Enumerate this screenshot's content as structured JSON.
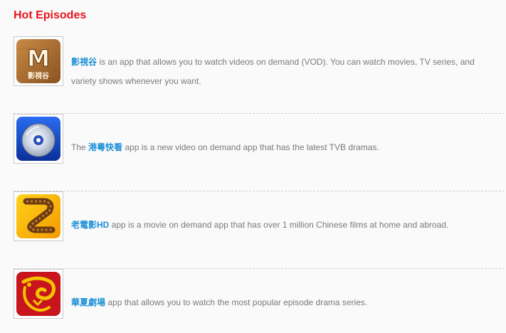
{
  "section": {
    "title": "Hot Episodes"
  },
  "episodes": [
    {
      "icon": "yingshigu-app-icon",
      "prefix": "",
      "name": "影視谷",
      "description": " is an app that allows you to watch videos on demand (VOD). You can watch movies, TV series, and variety shows whenever you want.",
      "icon_label": "影視谷",
      "icon_letter": "M"
    },
    {
      "icon": "gangyue-kuaikan-app-icon",
      "prefix": "The ",
      "name": "港粵快看",
      "description": " app is a new video on demand app that has the latest TVB dramas."
    },
    {
      "icon": "laodianying-hd-app-icon",
      "prefix": "",
      "name": "老電影HD",
      "description": " app is a movie on demand app that has over 1 million Chinese films at home and abroad."
    },
    {
      "icon": "huaxia-juchang-app-icon",
      "prefix": "",
      "name": "華夏劇場",
      "description": " app that allows you to watch the most popular episode drama series."
    }
  ],
  "colors": {
    "title": "#e8141c",
    "link": "#1a8fd6",
    "text": "#7a7a7a",
    "divider": "#cfcfcf",
    "background": "#fafafa"
  }
}
